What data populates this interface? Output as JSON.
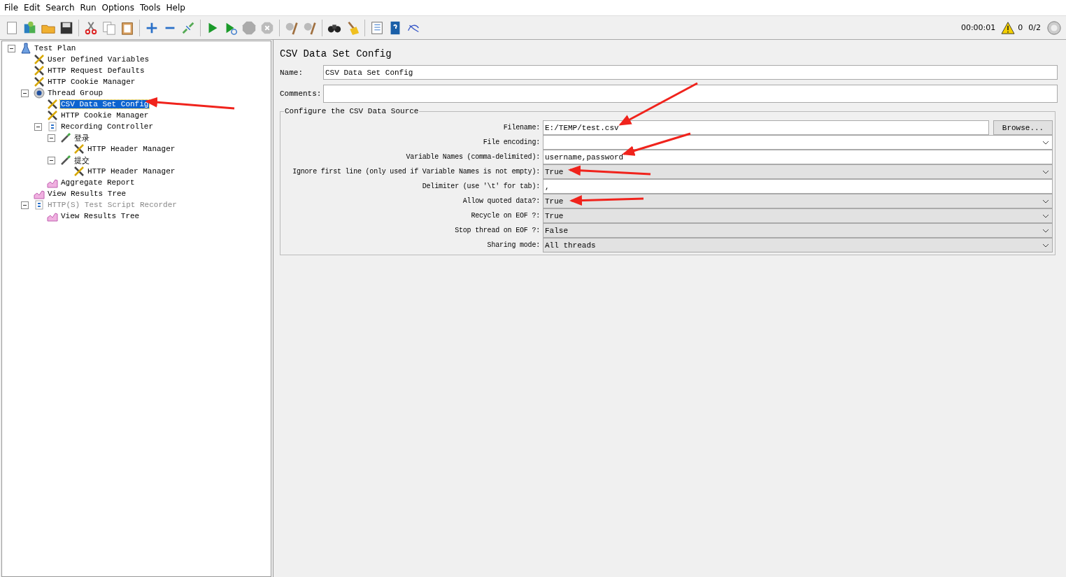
{
  "menu": [
    "File",
    "Edit",
    "Search",
    "Run",
    "Options",
    "Tools",
    "Help"
  ],
  "status": {
    "timer": "00:00:01",
    "warnings": "0",
    "threads": "0/2"
  },
  "tree": [
    {
      "label": "Test Plan",
      "kind": "plan",
      "selected": false,
      "disabled": false,
      "expanded": true,
      "children": [
        {
          "label": "User Defined Variables",
          "kind": "config",
          "selected": false,
          "disabled": false
        },
        {
          "label": "HTTP Request Defaults",
          "kind": "config",
          "selected": false,
          "disabled": false
        },
        {
          "label": "HTTP Cookie Manager",
          "kind": "config",
          "selected": false,
          "disabled": false
        },
        {
          "label": "Thread Group",
          "kind": "threadgroup",
          "selected": false,
          "disabled": false,
          "expanded": true,
          "children": [
            {
              "label": "CSV Data Set Config",
              "kind": "config",
              "selected": true,
              "disabled": false
            },
            {
              "label": "HTTP Cookie Manager",
              "kind": "config",
              "selected": false,
              "disabled": false
            },
            {
              "label": "Recording Controller",
              "kind": "controller",
              "selected": false,
              "disabled": false,
              "expanded": true,
              "children": [
                {
                  "label": "登录",
                  "kind": "sampler",
                  "selected": false,
                  "disabled": false,
                  "expanded": true,
                  "children": [
                    {
                      "label": "HTTP Header Manager",
                      "kind": "config",
                      "selected": false,
                      "disabled": false
                    }
                  ]
                },
                {
                  "label": "提交",
                  "kind": "sampler",
                  "selected": false,
                  "disabled": false,
                  "expanded": true,
                  "children": [
                    {
                      "label": "HTTP Header Manager",
                      "kind": "config",
                      "selected": false,
                      "disabled": false
                    }
                  ]
                }
              ]
            },
            {
              "label": "Aggregate Report",
              "kind": "listener",
              "selected": false,
              "disabled": false
            }
          ]
        },
        {
          "label": "View Results Tree",
          "kind": "listener",
          "selected": false,
          "disabled": false
        },
        {
          "label": "HTTP(S) Test Script Recorder",
          "kind": "controller",
          "selected": false,
          "disabled": true,
          "expanded": true,
          "children": [
            {
              "label": "View Results Tree",
              "kind": "listener",
              "selected": false,
              "disabled": false
            }
          ]
        }
      ]
    }
  ],
  "panel": {
    "title": "CSV Data Set Config",
    "name_label": "Name:",
    "name_value": "CSV Data Set Config",
    "comments_label": "Comments:",
    "group_title": "Configure the CSV Data Source",
    "fields": [
      {
        "label": "Filename:",
        "kind": "file",
        "value": "E:/TEMP/test.csv",
        "button": "Browse..."
      },
      {
        "label": "File encoding:",
        "kind": "editable-combo"
      },
      {
        "label": "Variable Names (comma-delimited):",
        "kind": "text",
        "value": "username,password"
      },
      {
        "label": "Ignore first line (only used if Variable Names is not empty):",
        "kind": "combo",
        "value": "True"
      },
      {
        "label": "Delimiter (use '\\t' for tab):",
        "kind": "text",
        "value": ","
      },
      {
        "label": "Allow quoted data?:",
        "kind": "combo",
        "value": "True"
      },
      {
        "label": "Recycle on EOF ?:",
        "kind": "combo",
        "value": "True"
      },
      {
        "label": "Stop thread on EOF ?:",
        "kind": "combo",
        "value": "False"
      },
      {
        "label": "Sharing mode:",
        "kind": "combo",
        "value": "All threads"
      }
    ]
  }
}
